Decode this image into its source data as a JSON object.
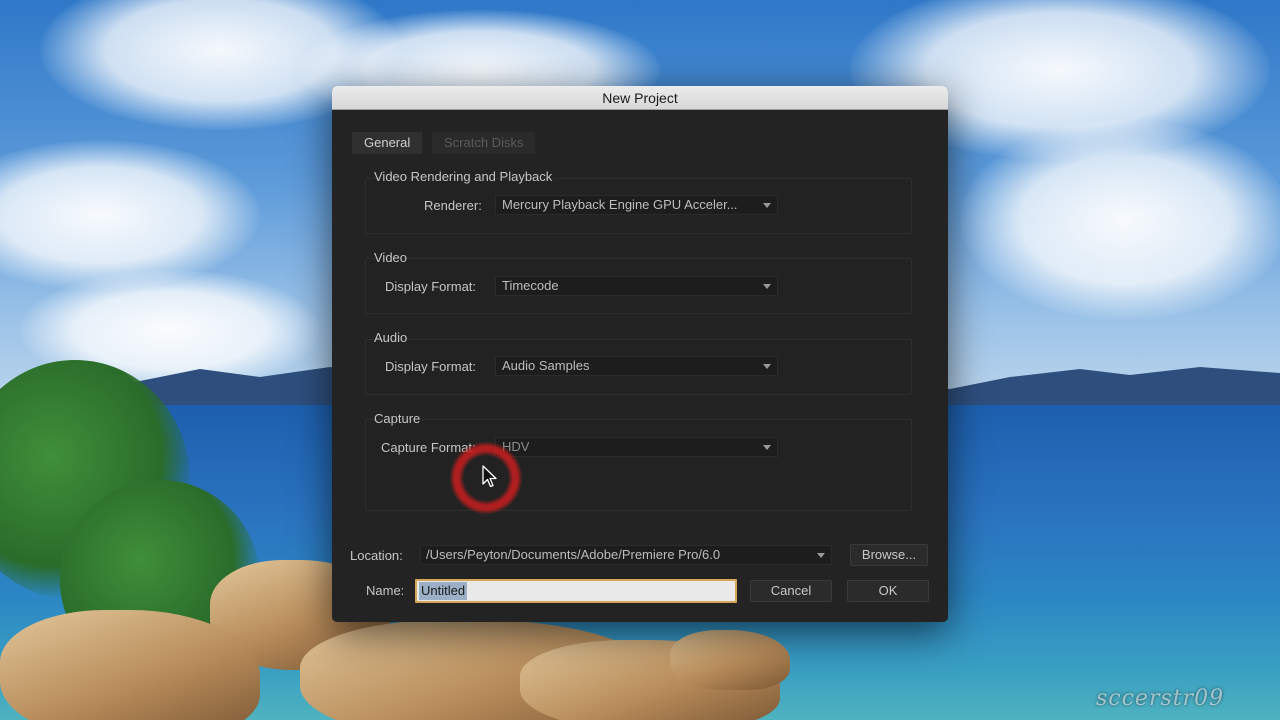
{
  "dialog": {
    "title": "New Project",
    "tabs": [
      {
        "label": "General",
        "active": true
      },
      {
        "label": "Scratch Disks",
        "active": false
      }
    ],
    "sections": {
      "video_rendering": {
        "title": "Video Rendering and Playback",
        "renderer_label": "Renderer:",
        "renderer_value": "Mercury Playback Engine GPU Acceler..."
      },
      "video": {
        "title": "Video",
        "display_format_label": "Display Format:",
        "display_format_value": "Timecode"
      },
      "audio": {
        "title": "Audio",
        "display_format_label": "Display Format:",
        "display_format_value": "Audio Samples"
      },
      "capture": {
        "title": "Capture",
        "capture_format_label": "Capture Format:",
        "capture_format_value": "HDV"
      }
    },
    "location": {
      "label": "Location:",
      "value": "/Users/Peyton/Documents/Adobe/Premiere Pro/6.0",
      "browse_label": "Browse..."
    },
    "name": {
      "label": "Name:",
      "value": "Untitled"
    },
    "buttons": {
      "cancel_label": "Cancel",
      "ok_label": "OK"
    }
  },
  "watermark": "sccerstr09",
  "colors": {
    "dialog_bg": "#232323",
    "name_field_focus": "#d7a55a",
    "click_indicator": "#c81e1e"
  },
  "icons": [
    "dropdown-caret-icon",
    "mouse-pointer-icon"
  ]
}
